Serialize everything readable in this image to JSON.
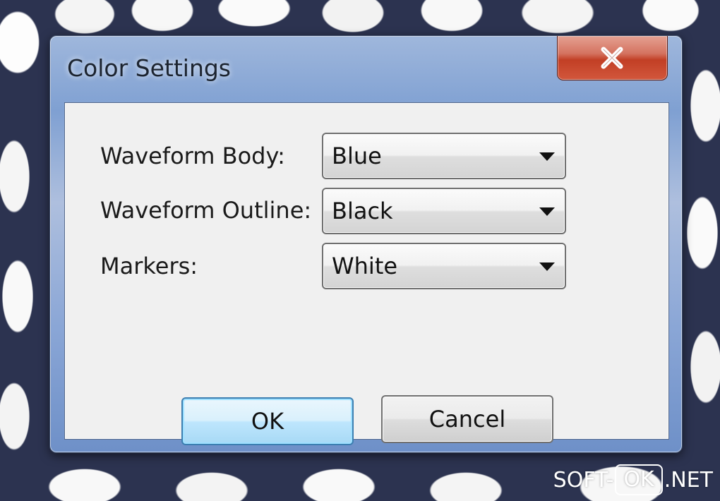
{
  "window": {
    "title": "Color Settings",
    "close_icon": "close-x-icon"
  },
  "fields": [
    {
      "label": "Waveform Body:",
      "value": "Blue"
    },
    {
      "label": "Waveform Outline:",
      "value": "Black"
    },
    {
      "label": "Markers:",
      "value": "White"
    }
  ],
  "buttons": {
    "ok": "OK",
    "cancel": "Cancel"
  },
  "watermark": {
    "left": "SOFT-",
    "boxed": "OK",
    "right": ".NET"
  },
  "colors": {
    "title_bar": "#8aa6d6",
    "client_bg": "#f0f0f0",
    "close_button": "#c23f25",
    "ok_focus": "#3c7fb1"
  }
}
